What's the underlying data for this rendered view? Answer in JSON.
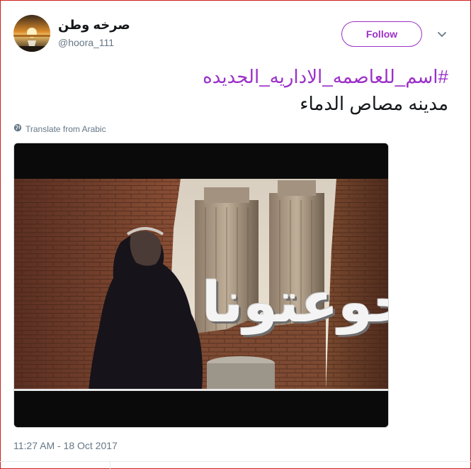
{
  "tweet": {
    "display_name": "صرخه وطن",
    "handle": "@hoora_111",
    "follow_label": "Follow",
    "hashtag": "#اسم_للعاصمه_الاداريه_الجديده",
    "text_line": "مدينه مصاص الدماء",
    "translate_label": "Translate from Arabic",
    "timestamp": "11:27 AM - 18 Oct 2017"
  },
  "media": {
    "overlay_text": "جوعتونا"
  },
  "colors": {
    "accent": "#9b30c8",
    "secondary_text": "#657786",
    "frame_border": "#cf1f1f"
  },
  "icons": {
    "avatar": "sunset-avatar",
    "caret": "chevron-down-icon",
    "translate": "globe-icon"
  }
}
